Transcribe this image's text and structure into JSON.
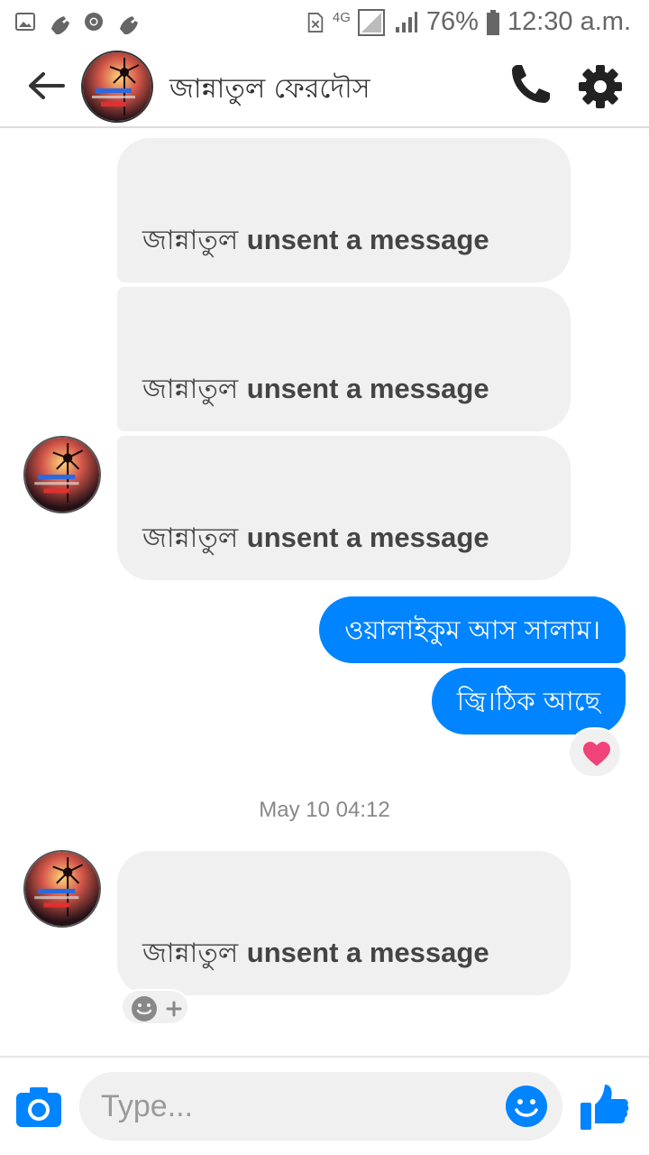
{
  "status_bar": {
    "network": "4G",
    "battery_percent": "76%",
    "time": "12:30 a.m.",
    "icons": [
      "gallery-icon",
      "missed-call-icon",
      "chrome-icon",
      "missed-call-icon",
      "no-sim-icon",
      "signal-icon",
      "battery-icon"
    ]
  },
  "header": {
    "contact_name": "জান্নাতুল ফেরদৌস",
    "icons": [
      "back-arrow-icon",
      "phone-icon",
      "gear-icon"
    ]
  },
  "messages": {
    "incoming": [
      {
        "name": "জান্নাতুল",
        "action": "unsent a message"
      },
      {
        "name": "জান্নাতুল",
        "action": "unsent a message"
      },
      {
        "name": "জান্নাতুল",
        "action": "unsent a message"
      },
      {
        "name": "জান্নাতুল",
        "action": "unsent a message"
      }
    ],
    "outgoing": [
      {
        "text": "ওয়ালাইকুম আস সালাম।"
      },
      {
        "text": "জ্বি।ঠিক আছে"
      }
    ],
    "reaction": "heart-icon",
    "timestamp": "May 10 04:12"
  },
  "composer": {
    "placeholder": "Type...",
    "icons": [
      "camera-icon",
      "emoji-icon",
      "thumbs-up-icon"
    ]
  },
  "colors": {
    "accent": "#0084ff",
    "incoming_bubble": "#f0f0f0",
    "reaction_heart": "#f0437a"
  }
}
